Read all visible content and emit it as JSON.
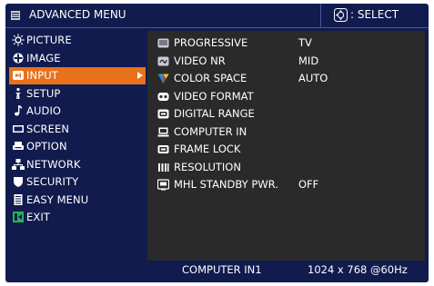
{
  "header": {
    "title": "ADVANCED MENU",
    "title_icon": "menu-list-icon",
    "select_hint": "SELECT",
    "select_icon": "dpad-icon"
  },
  "left_menu": {
    "items": [
      {
        "label": "PICTURE",
        "icon": "sun-icon",
        "active": false
      },
      {
        "label": "IMAGE",
        "icon": "image-icon",
        "active": false
      },
      {
        "label": "INPUT",
        "icon": "input-icon",
        "active": true
      },
      {
        "label": "SETUP",
        "icon": "setup-icon",
        "active": false
      },
      {
        "label": "AUDIO",
        "icon": "music-note-icon",
        "active": false
      },
      {
        "label": "SCREEN",
        "icon": "screen-icon",
        "active": false
      },
      {
        "label": "OPTION",
        "icon": "option-icon",
        "active": false
      },
      {
        "label": "NETWORK",
        "icon": "network-icon",
        "active": false
      },
      {
        "label": "SECURITY",
        "icon": "shield-icon",
        "active": false
      },
      {
        "label": "EASY MENU",
        "icon": "easy-menu-icon",
        "active": false
      },
      {
        "label": "EXIT",
        "icon": "exit-icon",
        "active": false
      }
    ]
  },
  "submenu": {
    "items": [
      {
        "label": "PROGRESSIVE",
        "value": "TV",
        "icon": "progressive-icon"
      },
      {
        "label": "VIDEO NR",
        "value": "MID",
        "icon": "video-nr-icon"
      },
      {
        "label": "COLOR SPACE",
        "value": "AUTO",
        "icon": "color-space-icon"
      },
      {
        "label": "VIDEO FORMAT",
        "value": "",
        "icon": "video-format-icon"
      },
      {
        "label": "DIGITAL RANGE",
        "value": "",
        "icon": "digital-range-icon"
      },
      {
        "label": "COMPUTER IN",
        "value": "",
        "icon": "computer-icon"
      },
      {
        "label": "FRAME LOCK",
        "value": "",
        "icon": "frame-lock-icon"
      },
      {
        "label": "RESOLUTION",
        "value": "",
        "icon": "resolution-icon"
      },
      {
        "label": "MHL STANDBY PWR.",
        "value": "OFF",
        "icon": "mhl-icon"
      }
    ]
  },
  "status": {
    "source": "COMPUTER IN1",
    "signal": "1024 x 768 @60Hz"
  },
  "colors": {
    "background": "#111b4e",
    "panel": "#2a2a2a",
    "highlight": "#e8711b",
    "text": "#ffffff"
  }
}
